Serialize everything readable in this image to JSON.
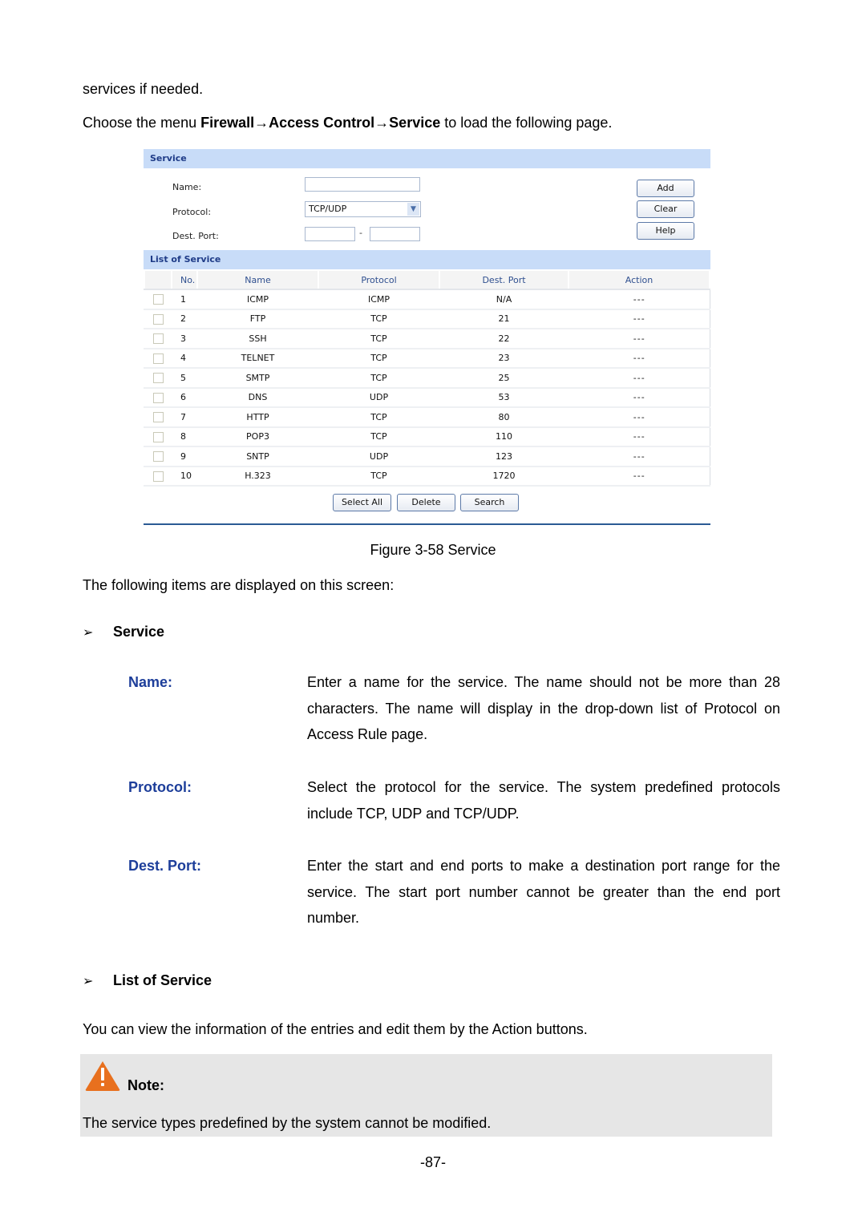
{
  "intro": {
    "line1": "services if needed.",
    "line2_prefix": "Choose the menu ",
    "menu_path": [
      "Firewall",
      "Access Control",
      "Service"
    ],
    "arrow": "→",
    "line2_suffix": " to load the following page."
  },
  "figure": {
    "service_section": {
      "title": "Service",
      "fields": {
        "name_label": "Name:",
        "name_value": "",
        "protocol_label": "Protocol:",
        "protocol_value": "TCP/UDP",
        "dest_port_label": "Dest. Port:",
        "port_start": "",
        "port_end": "",
        "port_separator": "-"
      },
      "buttons": {
        "add": "Add",
        "clear": "Clear",
        "help": "Help"
      }
    },
    "list_section": {
      "title": "List of Service",
      "columns": [
        "No.",
        "Name",
        "Protocol",
        "Dest. Port",
        "Action"
      ],
      "rows": [
        {
          "no": "1",
          "name": "ICMP",
          "protocol": "ICMP",
          "port": "N/A",
          "action": "---"
        },
        {
          "no": "2",
          "name": "FTP",
          "protocol": "TCP",
          "port": "21",
          "action": "---"
        },
        {
          "no": "3",
          "name": "SSH",
          "protocol": "TCP",
          "port": "22",
          "action": "---"
        },
        {
          "no": "4",
          "name": "TELNET",
          "protocol": "TCP",
          "port": "23",
          "action": "---"
        },
        {
          "no": "5",
          "name": "SMTP",
          "protocol": "TCP",
          "port": "25",
          "action": "---"
        },
        {
          "no": "6",
          "name": "DNS",
          "protocol": "UDP",
          "port": "53",
          "action": "---"
        },
        {
          "no": "7",
          "name": "HTTP",
          "protocol": "TCP",
          "port": "80",
          "action": "---"
        },
        {
          "no": "8",
          "name": "POP3",
          "protocol": "TCP",
          "port": "110",
          "action": "---"
        },
        {
          "no": "9",
          "name": "SNTP",
          "protocol": "UDP",
          "port": "123",
          "action": "---"
        },
        {
          "no": "10",
          "name": "H.323",
          "protocol": "TCP",
          "port": "1720",
          "action": "---"
        }
      ],
      "buttons": {
        "select_all": "Select All",
        "delete": "Delete",
        "search": "Search"
      }
    },
    "caption": "Figure 3-58 Service"
  },
  "items_intro": "The following items are displayed on this screen:",
  "sections": {
    "service": {
      "heading": "Service",
      "items": [
        {
          "term": "Name:",
          "desc": "Enter a name for the service. The name should not be more than 28 characters. The name will display in the drop-down list of Protocol on Access Rule page."
        },
        {
          "term": "Protocol:",
          "desc": "Select the protocol for the service. The system predefined protocols include TCP, UDP and TCP/UDP."
        },
        {
          "term": "Dest. Port:",
          "desc": "Enter the start and end ports to make a destination port range for the service. The start port number cannot be greater than the end port number."
        }
      ]
    },
    "list": {
      "heading": "List of Service",
      "text": "You can view the information of the entries and edit them by the Action buttons."
    }
  },
  "note": {
    "label": "Note:",
    "text": "The service types predefined by the system cannot be modified."
  },
  "page_number": "-87-",
  "colors": {
    "section_bar": "#c8dcf8",
    "term_blue": "#1d3e9a",
    "note_bg": "#e6e6e6",
    "warning_orange": "#e8701e"
  }
}
